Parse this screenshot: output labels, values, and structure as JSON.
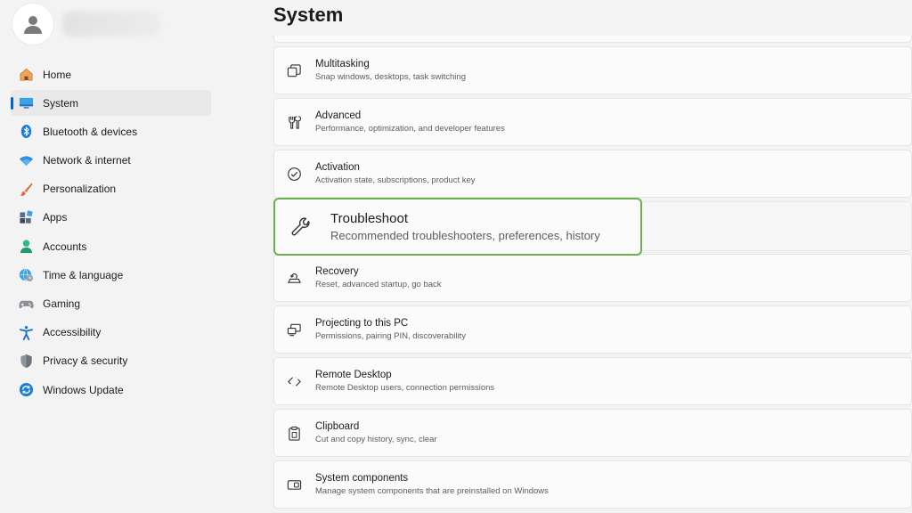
{
  "page": {
    "title": "System"
  },
  "sidebar": {
    "items": [
      {
        "label": "Home",
        "icon": "home-icon",
        "active": false
      },
      {
        "label": "System",
        "icon": "system-icon",
        "active": true
      },
      {
        "label": "Bluetooth & devices",
        "icon": "bluetooth-icon",
        "active": false
      },
      {
        "label": "Network & internet",
        "icon": "wifi-icon",
        "active": false
      },
      {
        "label": "Personalization",
        "icon": "brush-icon",
        "active": false
      },
      {
        "label": "Apps",
        "icon": "apps-icon",
        "active": false
      },
      {
        "label": "Accounts",
        "icon": "accounts-icon",
        "active": false
      },
      {
        "label": "Time & language",
        "icon": "globe-clock-icon",
        "active": false
      },
      {
        "label": "Gaming",
        "icon": "gamepad-icon",
        "active": false
      },
      {
        "label": "Accessibility",
        "icon": "accessibility-icon",
        "active": false
      },
      {
        "label": "Privacy & security",
        "icon": "shield-icon",
        "active": false
      },
      {
        "label": "Windows Update",
        "icon": "update-icon",
        "active": false
      }
    ]
  },
  "settings": {
    "multitasking": {
      "title": "Multitasking",
      "subtitle": "Snap windows, desktops, task switching",
      "icon": "multitasking-icon"
    },
    "advanced": {
      "title": "Advanced",
      "subtitle": "Performance, optimization, and developer features",
      "icon": "tools-icon"
    },
    "activation": {
      "title": "Activation",
      "subtitle": "Activation state, subscriptions, product key",
      "icon": "check-circle-icon"
    },
    "troubleshoot": {
      "title": "Troubleshoot",
      "subtitle": "Recommended troubleshooters, preferences, history",
      "icon": "wrench-icon"
    },
    "recovery": {
      "title": "Recovery",
      "subtitle": "Reset, advanced startup, go back",
      "icon": "recovery-icon"
    },
    "projecting": {
      "title": "Projecting to this PC",
      "subtitle": "Permissions, pairing PIN, discoverability",
      "icon": "projecting-icon"
    },
    "remote_desktop": {
      "title": "Remote Desktop",
      "subtitle": "Remote Desktop users, connection permissions",
      "icon": "remote-desktop-icon"
    },
    "clipboard": {
      "title": "Clipboard",
      "subtitle": "Cut and copy history, sync, clear",
      "icon": "clipboard-icon"
    },
    "system_components": {
      "title": "System components",
      "subtitle": "Manage system components that are preinstalled on Windows",
      "icon": "components-icon"
    }
  },
  "colors": {
    "accent": "#0067c0",
    "highlight_border": "#6ab04c",
    "background": "#f3f3f3",
    "card": "#fbfbfb"
  }
}
